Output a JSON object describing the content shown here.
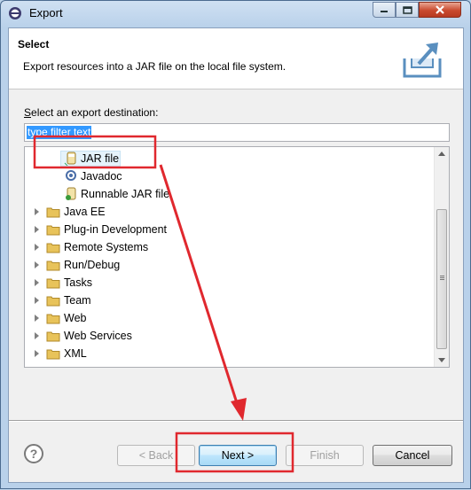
{
  "window": {
    "title": "Export"
  },
  "banner": {
    "title": "Select",
    "description": "Export resources into a JAR file on the local file system."
  },
  "destination": {
    "label": "Select an export destination:",
    "filter_value": "type filter text"
  },
  "tree": {
    "items": [
      {
        "label": "JAR file",
        "icon": "jar-file-icon",
        "level": 1,
        "selected": true
      },
      {
        "label": "Javadoc",
        "icon": "javadoc-icon",
        "level": 1
      },
      {
        "label": "Runnable JAR file",
        "icon": "runnable-jar-icon",
        "level": 1
      },
      {
        "label": "Java EE",
        "icon": "folder-icon",
        "level": 0,
        "expandable": true
      },
      {
        "label": "Plug-in Development",
        "icon": "folder-icon",
        "level": 0,
        "expandable": true
      },
      {
        "label": "Remote Systems",
        "icon": "folder-icon",
        "level": 0,
        "expandable": true
      },
      {
        "label": "Run/Debug",
        "icon": "folder-icon",
        "level": 0,
        "expandable": true
      },
      {
        "label": "Tasks",
        "icon": "folder-icon",
        "level": 0,
        "expandable": true
      },
      {
        "label": "Team",
        "icon": "folder-icon",
        "level": 0,
        "expandable": true
      },
      {
        "label": "Web",
        "icon": "folder-icon",
        "level": 0,
        "expandable": true
      },
      {
        "label": "Web Services",
        "icon": "folder-icon",
        "level": 0,
        "expandable": true
      },
      {
        "label": "XML",
        "icon": "folder-icon",
        "level": 0,
        "expandable": true
      }
    ]
  },
  "buttons": {
    "help": "?",
    "back": "< Back",
    "next": "Next >",
    "finish": "Finish",
    "cancel": "Cancel"
  },
  "colors": {
    "annotation": "#e0282e",
    "selection": "#3399ff",
    "folder": "#e8c35a"
  }
}
